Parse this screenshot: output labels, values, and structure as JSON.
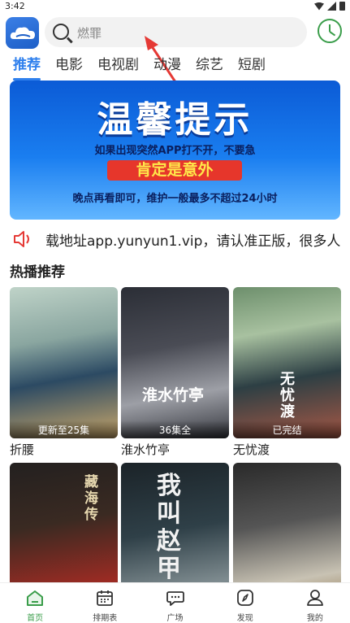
{
  "status_bar": {
    "time": "3:42"
  },
  "search": {
    "placeholder": "燃罪"
  },
  "tabs": [
    {
      "label": "推荐",
      "active": true
    },
    {
      "label": "电影"
    },
    {
      "label": "电视剧"
    },
    {
      "label": "动漫"
    },
    {
      "label": "综艺"
    },
    {
      "label": "短剧"
    }
  ],
  "banner": {
    "title": "温馨提示",
    "line1": "如果出现突然APP打不开，不要急",
    "line2": "肯定是意外",
    "line3": "晚点再看即可，维护一般最多不超过24小时"
  },
  "notice": {
    "text": "载地址app.yunyun1.vip，请认准正版，很多人"
  },
  "section": {
    "title": "热播推荐"
  },
  "cards": [
    {
      "name": "折腰",
      "badge": "更新至25集"
    },
    {
      "name": "淮水竹亭",
      "badge": "36集全",
      "poster_title": "淮水竹亭"
    },
    {
      "name": "无忧渡",
      "badge": "已完结",
      "poster_title": "无忧渡"
    },
    {
      "name": "",
      "badge": "",
      "poster_title": "藏海传"
    },
    {
      "name": "",
      "badge": "",
      "poster_title": "我叫赵甲第"
    },
    {
      "name": "",
      "badge": "",
      "poster_title": ""
    }
  ],
  "bottom_nav": [
    {
      "label": "首页",
      "icon": "home-icon",
      "active": true
    },
    {
      "label": "排期表",
      "icon": "calendar-icon"
    },
    {
      "label": "广场",
      "icon": "chat-icon"
    },
    {
      "label": "发现",
      "icon": "compass-icon"
    },
    {
      "label": "我的",
      "icon": "profile-icon"
    }
  ],
  "colors": {
    "accent": "#2f80ed",
    "nav_active": "#3a9d4a",
    "arrow": "#e53935"
  }
}
